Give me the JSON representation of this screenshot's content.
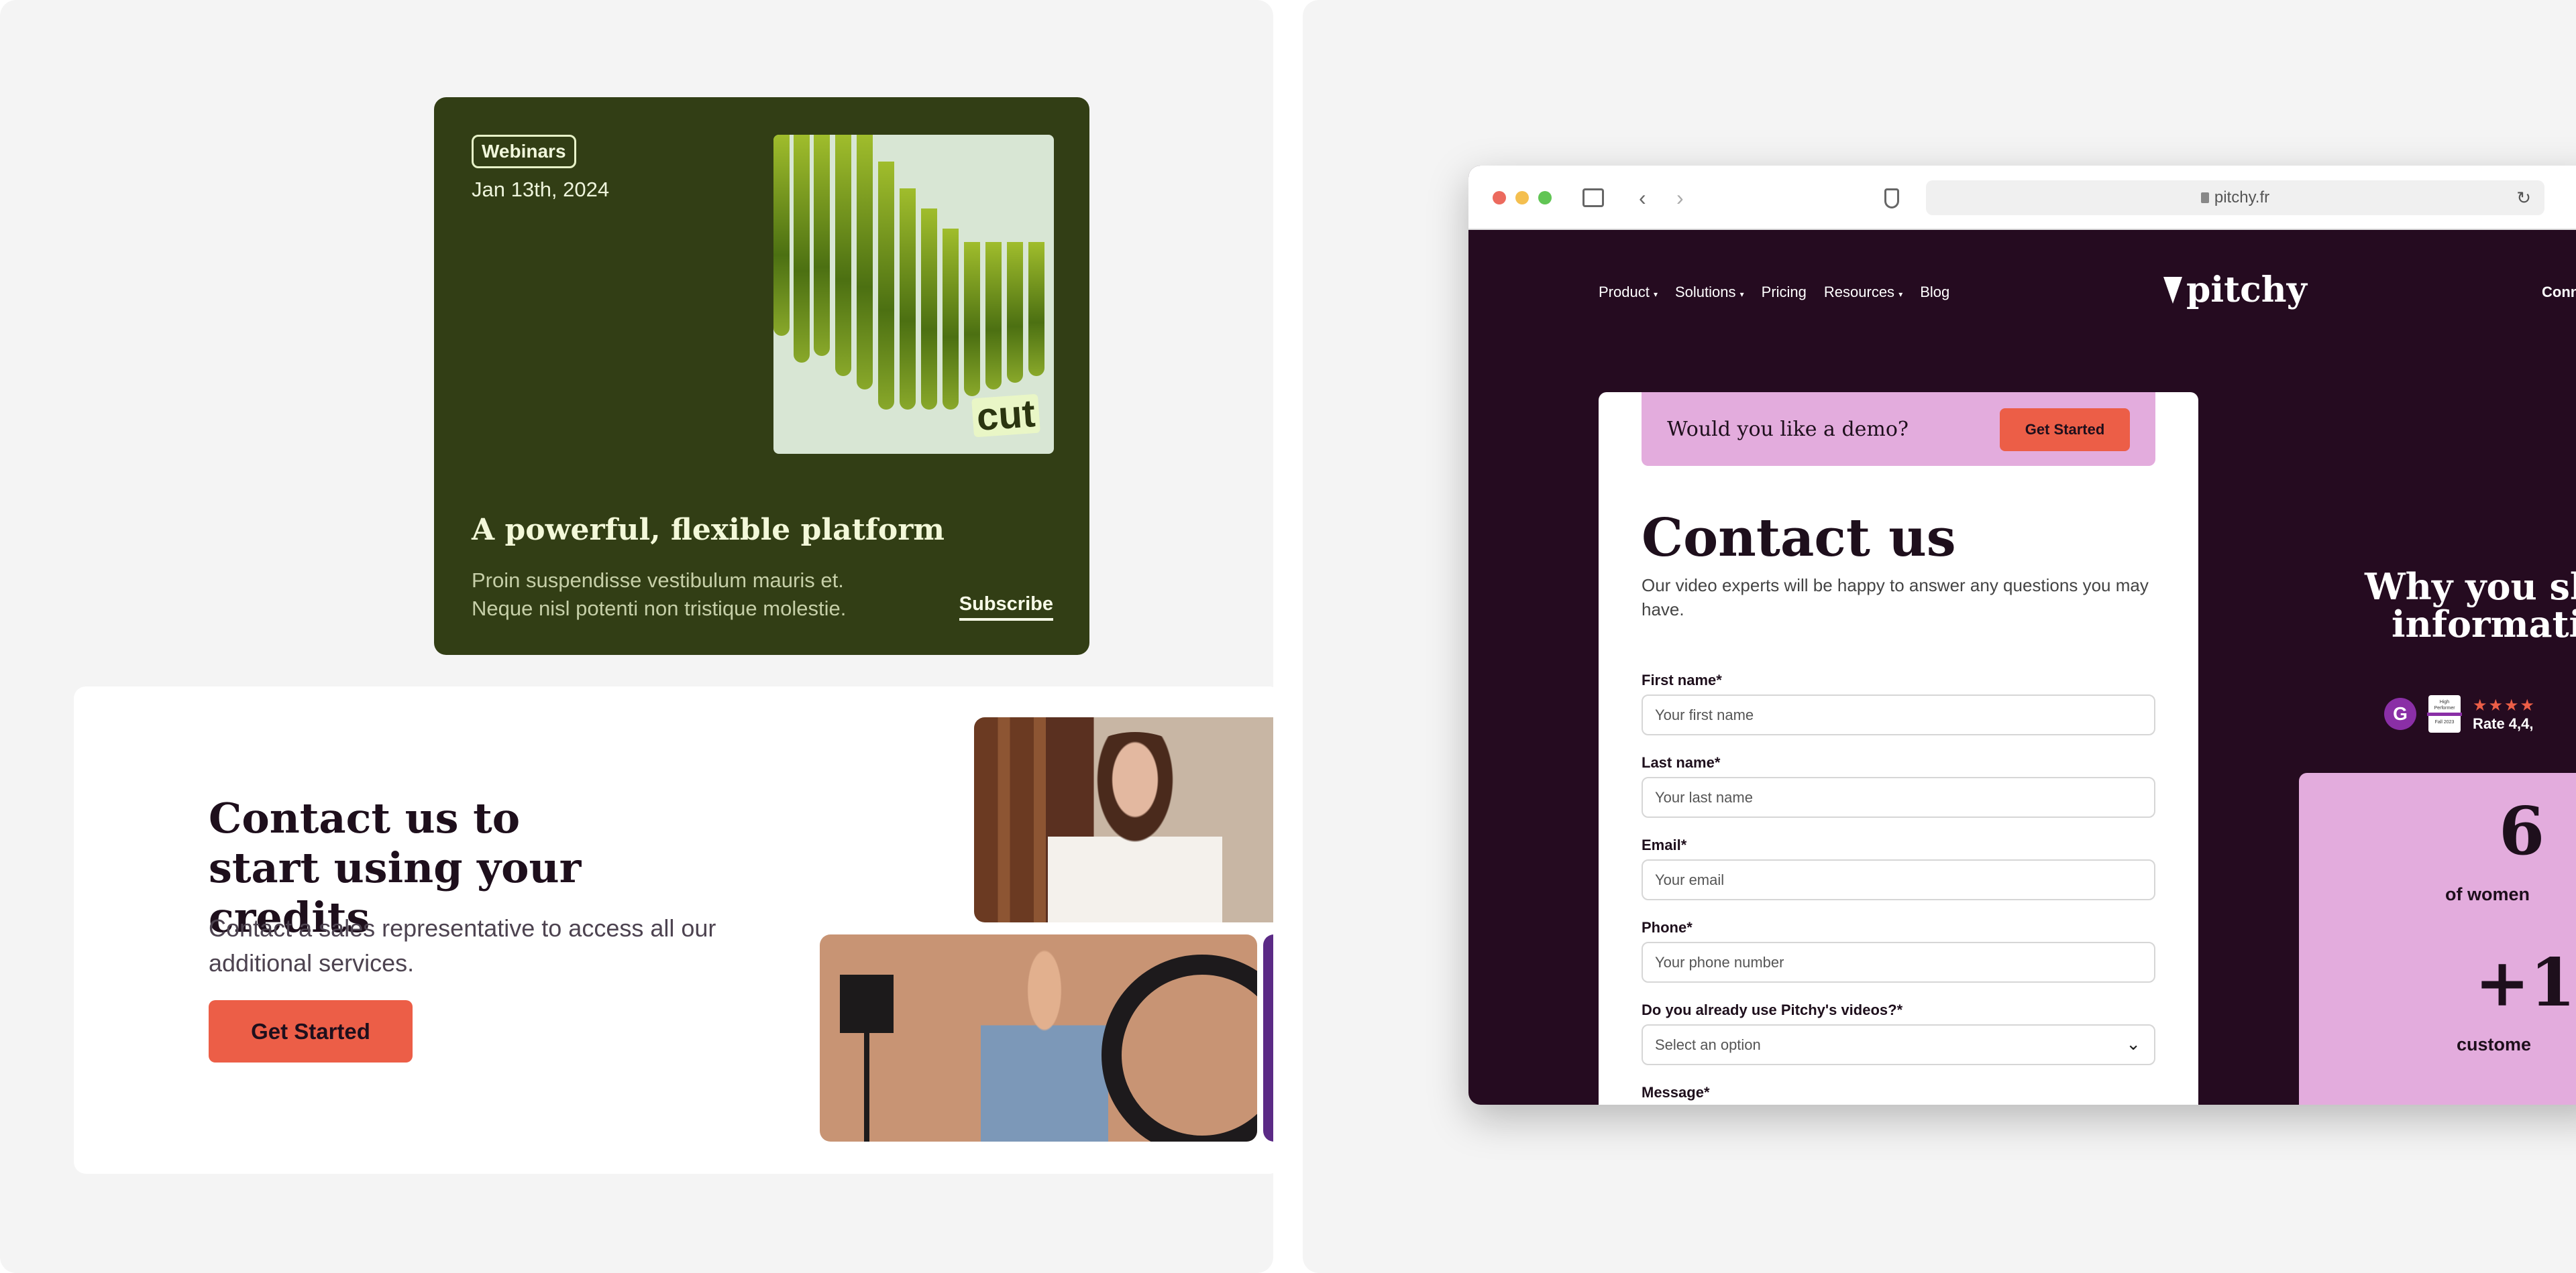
{
  "webinar_card": {
    "tag": "Webinars",
    "date": "Jan 13th, 2024",
    "image_caption": "cut",
    "title": "A powerful, flexible platform",
    "description_line1": "Proin suspendisse vestibulum mauris et.",
    "description_line2": "Neque nisl potenti non tristique molestie.",
    "subscribe_label": "Subscribe",
    "background_color": "#323e15"
  },
  "credits_card": {
    "title": "Contact us to start using your credits",
    "description": "Contact a sales representative to access all our additional services.",
    "button_label": "Get Started",
    "accent_color": "#ec5e47"
  },
  "browser": {
    "url": "pitchy.fr",
    "icons": [
      "sidebar-icon",
      "back-icon",
      "forward-icon",
      "shield-icon",
      "lock-icon",
      "reload-icon"
    ]
  },
  "site": {
    "nav": [
      {
        "label": "Product",
        "dropdown": true
      },
      {
        "label": "Solutions",
        "dropdown": true
      },
      {
        "label": "Pricing",
        "dropdown": false
      },
      {
        "label": "Resources",
        "dropdown": true
      },
      {
        "label": "Blog",
        "dropdown": false
      }
    ],
    "logo_text": "pitchy",
    "right_nav_partial": "Conn",
    "background_color": "#250b20",
    "demo_banner": {
      "text": "Would you like a demo?",
      "button_label": "Get Started",
      "color": "#e3acdd"
    },
    "form": {
      "title": "Contact us",
      "description": "Our video experts will be happy to answer any questions you may have.",
      "fields": [
        {
          "label": "First name*",
          "placeholder": "Your first name"
        },
        {
          "label": "Last name*",
          "placeholder": "Your last name"
        },
        {
          "label": "Email*",
          "placeholder": "Your email"
        },
        {
          "label": "Phone*",
          "placeholder": "Your phone number"
        }
      ],
      "select": {
        "label": "Do you already use Pitchy's videos?*",
        "value": "Select an option"
      },
      "message_label": "Message*"
    },
    "why": {
      "line1": "Why you sh",
      "line2": "informati"
    },
    "ratings": {
      "g2": "G",
      "badge_line1": "High",
      "badge_line2": "Performer",
      "badge_line3": "Fall 2023",
      "stars": "★★★★",
      "rate_text": "Rate 4,4,"
    },
    "stats": [
      {
        "value": "6",
        "label": "of women"
      },
      {
        "value": "+1",
        "label": "custome"
      }
    ]
  }
}
